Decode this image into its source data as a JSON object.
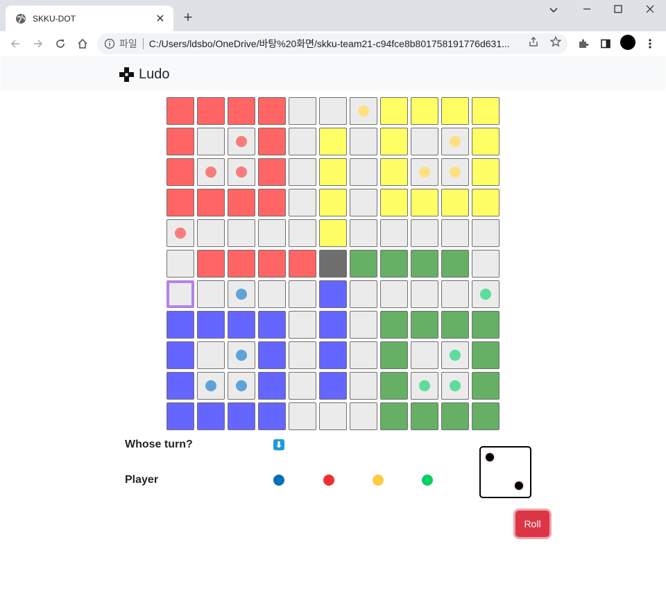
{
  "browser": {
    "tab_title": "SKKU-DOT",
    "scheme_label": "파일",
    "url": "C:/Users/ldsbo/OneDrive/바탕%20화면/skku-team21-c94fce8b801758191776d631..."
  },
  "app": {
    "brand": "Ludo"
  },
  "board": {
    "rows": [
      [
        "red",
        "red",
        "red",
        "red",
        "gray",
        "gray",
        "gray",
        "yellow",
        "yellow",
        "yellow",
        "yellow"
      ],
      [
        "red",
        "gray",
        "gray",
        "red",
        "gray",
        "yellow",
        "gray",
        "yellow",
        "gray",
        "gray",
        "yellow"
      ],
      [
        "red",
        "gray",
        "gray",
        "red",
        "gray",
        "yellow",
        "gray",
        "yellow",
        "gray",
        "gray",
        "yellow"
      ],
      [
        "red",
        "red",
        "red",
        "red",
        "gray",
        "yellow",
        "gray",
        "yellow",
        "yellow",
        "yellow",
        "yellow"
      ],
      [
        "gray",
        "gray",
        "gray",
        "gray",
        "gray",
        "yellow",
        "gray",
        "gray",
        "gray",
        "gray",
        "gray"
      ],
      [
        "gray",
        "red",
        "red",
        "red",
        "red",
        "center",
        "green",
        "green",
        "green",
        "green",
        "gray"
      ],
      [
        "gray",
        "gray",
        "gray",
        "gray",
        "gray",
        "blue",
        "gray",
        "gray",
        "gray",
        "gray",
        "gray"
      ],
      [
        "blue",
        "blue",
        "blue",
        "blue",
        "gray",
        "blue",
        "gray",
        "green",
        "green",
        "green",
        "green"
      ],
      [
        "blue",
        "gray",
        "gray",
        "blue",
        "gray",
        "blue",
        "gray",
        "green",
        "gray",
        "gray",
        "green"
      ],
      [
        "blue",
        "gray",
        "gray",
        "blue",
        "gray",
        "blue",
        "gray",
        "green",
        "gray",
        "gray",
        "green"
      ],
      [
        "blue",
        "blue",
        "blue",
        "blue",
        "gray",
        "gray",
        "gray",
        "green",
        "green",
        "green",
        "green"
      ]
    ],
    "highlight": [
      6,
      0
    ],
    "pieces": [
      {
        "player": "yellow",
        "row": 0,
        "col": 6
      },
      {
        "player": "red",
        "row": 1,
        "col": 2
      },
      {
        "player": "yellow",
        "row": 1,
        "col": 9
      },
      {
        "player": "red",
        "row": 2,
        "col": 1
      },
      {
        "player": "red",
        "row": 2,
        "col": 2
      },
      {
        "player": "yellow",
        "row": 2,
        "col": 8
      },
      {
        "player": "yellow",
        "row": 2,
        "col": 9
      },
      {
        "player": "red",
        "row": 4,
        "col": 0
      },
      {
        "player": "blue",
        "row": 6,
        "col": 2
      },
      {
        "player": "green",
        "row": 6,
        "col": 10
      },
      {
        "player": "blue",
        "row": 8,
        "col": 2
      },
      {
        "player": "green",
        "row": 8,
        "col": 9
      },
      {
        "player": "blue",
        "row": 9,
        "col": 1
      },
      {
        "player": "blue",
        "row": 9,
        "col": 2
      },
      {
        "player": "green",
        "row": 9,
        "col": 8
      },
      {
        "player": "green",
        "row": 9,
        "col": 9
      }
    ],
    "piece_colors": {
      "red": "#f87c7c",
      "yellow": "#ffe07e",
      "blue": "#5ea3d8",
      "green": "#5ddc9c"
    }
  },
  "status": {
    "whose_turn_label": "Whose turn?",
    "turn_icon": "arrow-down-icon",
    "player_label": "Player",
    "players": [
      {
        "name": "blue",
        "color": "#0570b9"
      },
      {
        "name": "red",
        "color": "#f22e2e"
      },
      {
        "name": "yellow",
        "color": "#fdca41"
      },
      {
        "name": "green",
        "color": "#08ce68"
      }
    ]
  },
  "dice": {
    "value": 2
  },
  "roll_button": "Roll"
}
